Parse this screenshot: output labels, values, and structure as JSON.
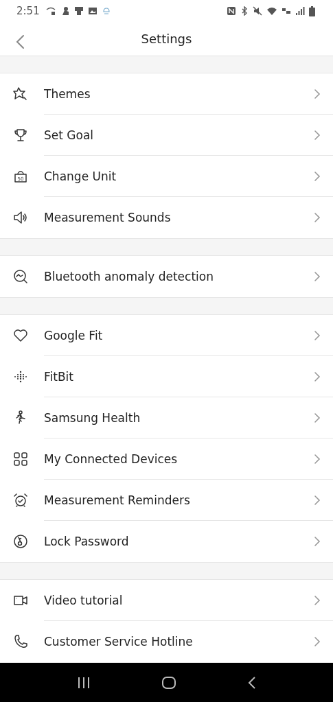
{
  "status_bar": {
    "time": "2:51"
  },
  "header": {
    "title": "Settings"
  },
  "groups": [
    {
      "items": [
        {
          "kind": "star",
          "label": "Themes"
        },
        {
          "kind": "trophy",
          "label": "Set Goal"
        },
        {
          "kind": "weight",
          "label": "Change Unit",
          "icon_text": "50"
        },
        {
          "kind": "speaker",
          "label": "Measurement Sounds"
        }
      ]
    },
    {
      "items": [
        {
          "kind": "scan",
          "label": "Bluetooth anomaly detection"
        }
      ]
    },
    {
      "items": [
        {
          "kind": "heart",
          "label": "Google Fit"
        },
        {
          "kind": "dots",
          "label": "FitBit"
        },
        {
          "kind": "runner",
          "label": "Samsung Health"
        },
        {
          "kind": "grid",
          "label": "My Connected Devices"
        },
        {
          "kind": "alarm",
          "label": "Measurement Reminders"
        },
        {
          "kind": "lock",
          "label": "Lock Password"
        }
      ]
    },
    {
      "items": [
        {
          "kind": "video",
          "label": "Video tutorial"
        },
        {
          "kind": "phone",
          "label": "Customer Service Hotline"
        }
      ]
    }
  ]
}
